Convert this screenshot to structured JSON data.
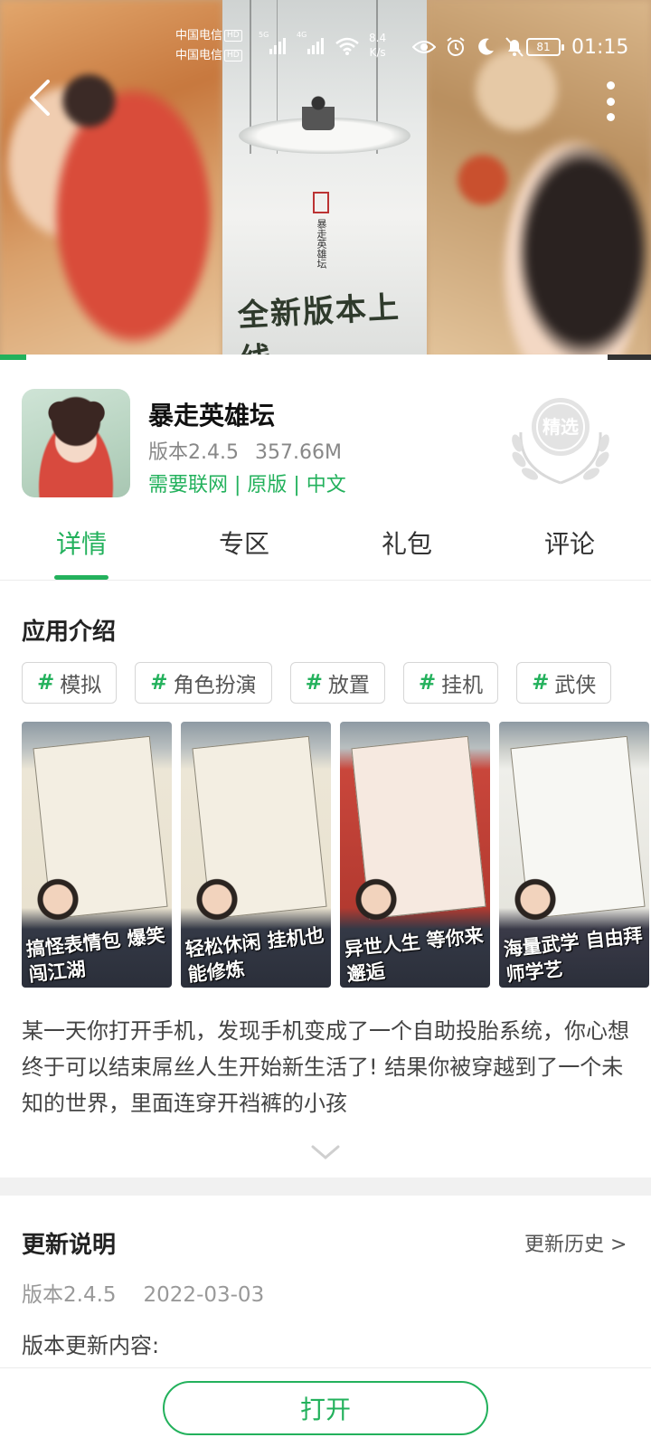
{
  "status_bar": {
    "carrier_1": "中国电信",
    "carrier_2": "中国电信",
    "hd": "HD",
    "net_5g": "5G",
    "net_4g": "4G",
    "speed_value": "8.4",
    "speed_unit": "K/s",
    "battery": "81",
    "time": "01:15"
  },
  "banner": {
    "vertical_title": "暴走英雄坛",
    "slogan": "全新版本上线",
    "progress_fraction": 0.04
  },
  "app": {
    "name": "暴走英雄坛",
    "version": "版本2.4.5",
    "size": "357.66M",
    "tags_line": "需要联网 | 原版 | 中文",
    "badge": "精选"
  },
  "tabs": [
    {
      "label": "详情",
      "active": true
    },
    {
      "label": "专区",
      "active": false
    },
    {
      "label": "礼包",
      "active": false
    },
    {
      "label": "评论",
      "active": false
    }
  ],
  "intro": {
    "title": "应用介绍",
    "chips": [
      "模拟",
      "角色扮演",
      "放置",
      "挂机",
      "武侠"
    ],
    "hash": "#",
    "screenshots": [
      {
        "caption": "搞怪表情包 爆笑闯江湖"
      },
      {
        "caption": "轻松休闲 挂机也能修炼"
      },
      {
        "caption": "异世人生 等你来邂逅"
      },
      {
        "caption": "海量武学 自由拜师学艺"
      }
    ],
    "description": "某一天你打开手机，发现手机变成了一个自助投胎系统，你心想终于可以结束屌丝人生开始新生活了! 结果你被穿越到了一个未知的世界，里面连穿开裆裤的小孩"
  },
  "update": {
    "title": "更新说明",
    "history_link": "更新历史 >",
    "version": "版本2.4.5",
    "date": "2022-03-03",
    "content_label": "版本更新内容:"
  },
  "bottom": {
    "open_label": "打开"
  },
  "colors": {
    "accent": "#23b15c",
    "text": "#222222",
    "muted": "#888888"
  }
}
